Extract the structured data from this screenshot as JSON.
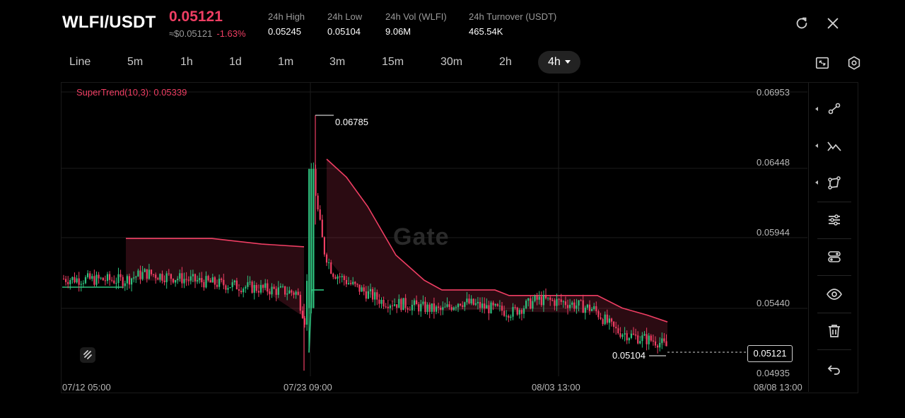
{
  "header": {
    "pair": "WLFI/USDT",
    "last_price": "0.05121",
    "usd_price": "≈$0.05121",
    "change": "-1.63%",
    "stats": [
      {
        "label": "24h   High",
        "value": "0.05245"
      },
      {
        "label": "24h   Low",
        "value": "0.05104"
      },
      {
        "label": "24h   Vol (WLFI)",
        "value": "9.06M"
      },
      {
        "label": "24h   Turnover (USDT)",
        "value": "465.54K"
      }
    ],
    "icons": [
      "refresh-icon",
      "close-icon"
    ]
  },
  "timeframes": [
    "Line",
    "5m",
    "1h",
    "1d",
    "1m",
    "3m",
    "15m",
    "30m",
    "2h",
    "4h"
  ],
  "active_timeframe": "4h",
  "chart_data": {
    "type": "candlestick",
    "indicator_label": "SuperTrend(10,3): 0.05339",
    "y_ticks": [
      "0.06953",
      "0.06448",
      "0.05944",
      "0.05440",
      "0.04935"
    ],
    "x_ticks": [
      "07/12 05:00",
      "07/23 09:00",
      "08/03 13:00",
      "08/08 13:00"
    ],
    "high_annotation": "0.06785",
    "low_annotation": "0.05104",
    "current_price": "0.05121",
    "watermark": "Gate",
    "ylim": [
      0.04935,
      0.06953
    ],
    "colors": {
      "up": "#2ec27e",
      "down": "#ef3e63",
      "supertrend_down": "#ef3e63",
      "supertrend_up": "#2ec27e"
    }
  },
  "toolbar": [
    "line-tool-icon",
    "trend-tool-icon",
    "shape-tool-icon",
    "settings-sliders-icon",
    "indicator-toggle-icon",
    "eye-icon",
    "trash-icon",
    "undo-icon"
  ]
}
